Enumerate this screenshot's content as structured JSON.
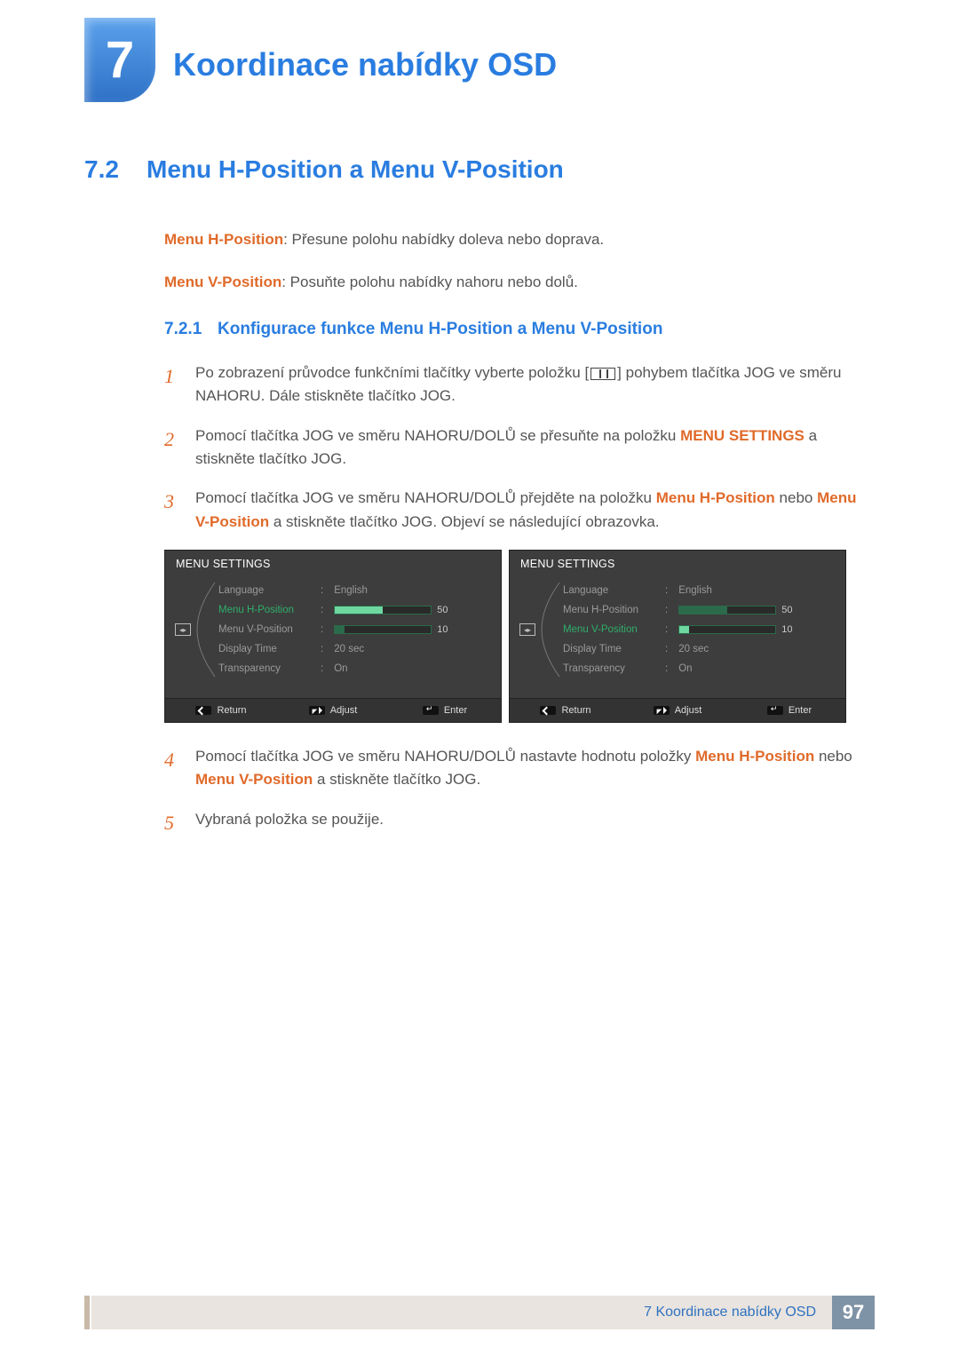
{
  "chapter": {
    "number": "7",
    "title": "Koordinace nabídky OSD"
  },
  "section": {
    "number": "7.2",
    "title": "Menu H-Position a Menu V-Position"
  },
  "intro": {
    "h_label": "Menu H-Position",
    "h_text": ": Přesune polohu nabídky doleva nebo doprava.",
    "v_label": "Menu V-Position",
    "v_text": ": Posuňte polohu nabídky nahoru nebo dolů."
  },
  "subsection": {
    "number": "7.2.1",
    "title": "Konfigurace funkce Menu H-Position a Menu V-Position"
  },
  "steps": {
    "s1a": "Po zobrazení průvodce funkčními tlačítky vyberte položku [",
    "s1b": "] pohybem tlačítka JOG ve směru NAHORU. Dále stiskněte tlačítko JOG.",
    "s2a": "Pomocí tlačítka JOG ve směru NAHORU/DOLŮ se přesuňte na položku ",
    "s2_ms": "MENU SETTINGS",
    "s2b": " a stiskněte tlačítko JOG.",
    "s3a": "Pomocí tlačítka JOG ve směru NAHORU/DOLŮ přejděte na položku ",
    "s3_h": "Menu H-Position",
    "s3_or": " nebo ",
    "s3_v": "Menu V-Position",
    "s3b": " a stiskněte tlačítko JOG. Objeví se následující obrazovka.",
    "s4a": "Pomocí tlačítka JOG ve směru NAHORU/DOLŮ nastavte hodnotu položky ",
    "s4_h": "Menu H-Position",
    "s4_or": " nebo ",
    "s4_v": "Menu V-Position",
    "s4b": " a stiskněte tlačítko JOG.",
    "s5": "Vybraná položka se použije."
  },
  "osd": {
    "title": "MENU SETTINGS",
    "rows": {
      "language": "Language",
      "h": "Menu H-Position",
      "v": "Menu V-Position",
      "display_time": "Display Time",
      "transparency": "Transparency"
    },
    "vals": {
      "english": "English",
      "h": "50",
      "v": "10",
      "display_time": "20 sec",
      "transparency": "On"
    },
    "footer": {
      "return": "Return",
      "adjust": "Adjust",
      "enter": "Enter"
    }
  },
  "footer": {
    "text": "7 Koordinace nabídky OSD",
    "page": "97"
  }
}
